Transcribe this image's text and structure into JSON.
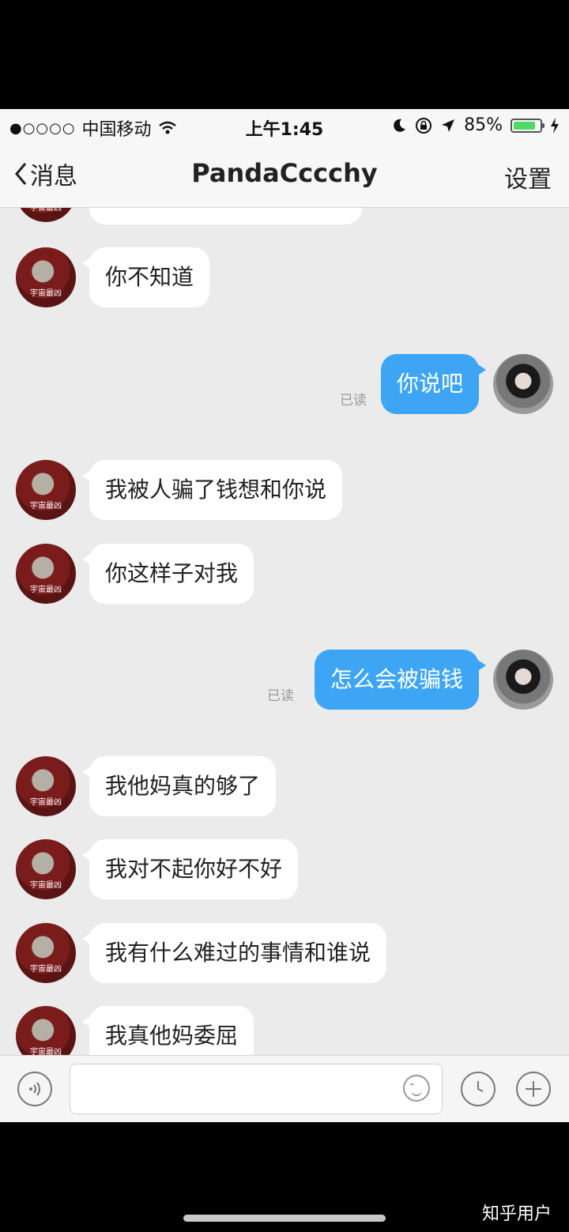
{
  "status_bar": {
    "signal": "●○○○○",
    "carrier": "中国移动",
    "time": "上午1:45",
    "battery_percent": "85%",
    "battery_level": 0.85
  },
  "nav": {
    "back_label": "消息",
    "title": "PandaCccchy",
    "settings_label": "设置"
  },
  "avatar_caption": "宇宙最凶",
  "messages": [
    {
      "side": "in",
      "text": ""
    },
    {
      "side": "in",
      "text": "你不知道"
    },
    {
      "side": "out",
      "text": "你说吧",
      "status": "已读"
    },
    {
      "side": "in",
      "text": "我被人骗了钱想和你说"
    },
    {
      "side": "in",
      "text": "你这样子对我"
    },
    {
      "side": "out",
      "text": "怎么会被骗钱",
      "status": "已读"
    },
    {
      "side": "in",
      "text": "我他妈真的够了"
    },
    {
      "side": "in",
      "text": "我对不起你好不好"
    },
    {
      "side": "in",
      "text": "我有什么难过的事情和谁说"
    },
    {
      "side": "in",
      "text": "我真他妈委屈"
    }
  ],
  "watermark": "知乎用户",
  "colors": {
    "outgoing_bubble": "#3ea5f5",
    "incoming_bubble": "#ffffff",
    "chat_background": "#ebebeb",
    "battery": "#4cd964"
  },
  "icons": {
    "voice": "voice-icon",
    "emoji": "emoji-icon",
    "clock": "clock-icon",
    "plus": "plus-icon"
  }
}
